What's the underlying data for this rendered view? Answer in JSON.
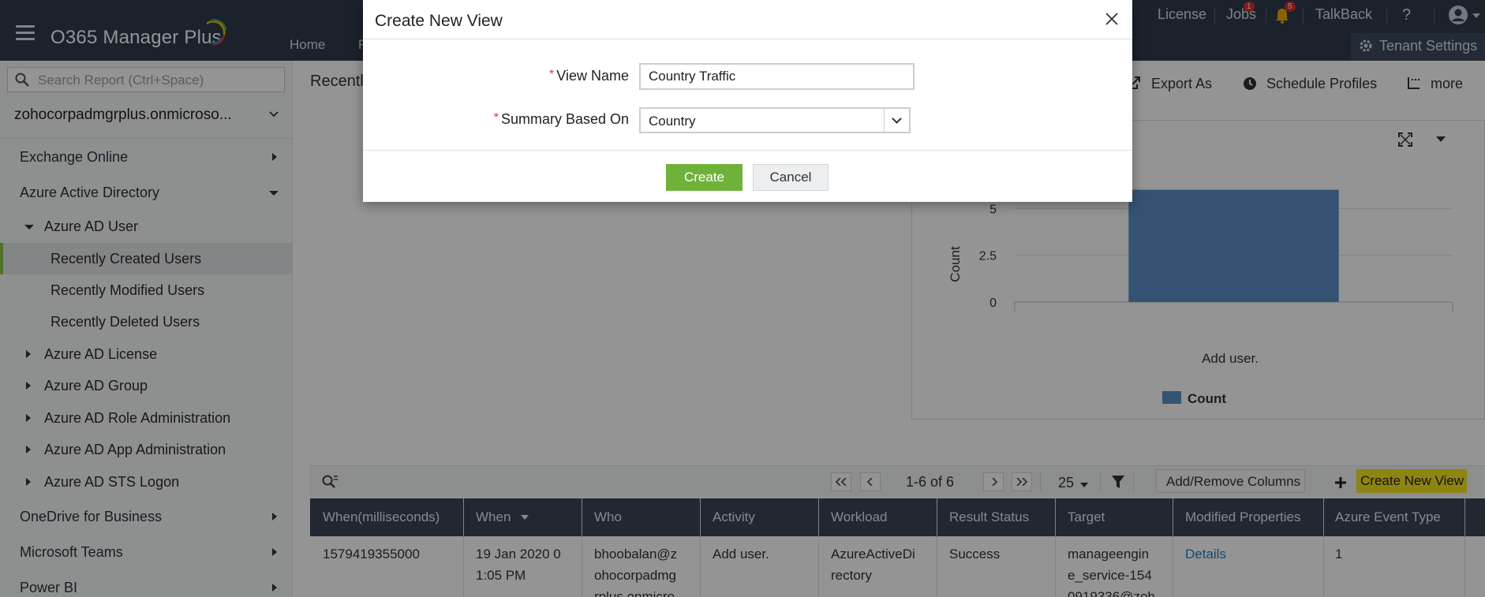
{
  "header": {
    "app_title": "O365 Manager Plus",
    "nav_home": "Home",
    "nav_partial": "F",
    "license": "License",
    "jobs": "Jobs",
    "jobs_badge": "1",
    "alerts_badge": "5",
    "talkback": "TalkBack",
    "help": "?",
    "tenant_settings": "Tenant Settings"
  },
  "sidebar": {
    "search_placeholder": "Search Report (Ctrl+Space)",
    "tenant": "zohocorpadmgrplus.onmicroso...",
    "items": [
      {
        "label": "Exchange Online"
      },
      {
        "label": "Azure Active Directory"
      },
      {
        "label": "Azure AD User"
      },
      {
        "label": "Recently Created Users"
      },
      {
        "label": "Recently Modified Users"
      },
      {
        "label": "Recently Deleted Users"
      },
      {
        "label": "Azure AD License"
      },
      {
        "label": "Azure AD Group"
      },
      {
        "label": "Azure AD Role Administration"
      },
      {
        "label": "Azure AD App Administration"
      },
      {
        "label": "Azure AD STS Logon"
      },
      {
        "label": "OneDrive for Business"
      },
      {
        "label": "Microsoft Teams"
      },
      {
        "label": "Power BI"
      }
    ]
  },
  "main": {
    "title_partial": "Recentl",
    "export_as": "Export As",
    "schedule_profiles": "Schedule Profiles",
    "more": "more"
  },
  "chart_data": {
    "type": "bar",
    "categories": [
      "Add user."
    ],
    "series": [
      {
        "name": "Count",
        "values": [
          6
        ]
      }
    ],
    "ylabel": "Count",
    "yticks": [
      "0",
      "2.5",
      "5"
    ],
    "ylim": [
      0,
      7.5
    ],
    "legend_position": "bottom",
    "bar_color": "#5b8fc7"
  },
  "table": {
    "pager": "1-6 of 6",
    "page_size": "25",
    "add_remove_columns": "Add/Remove Columns",
    "create_new_view": "Create New View",
    "columns": [
      "When(milliseconds)",
      "When",
      "Who",
      "Activity",
      "Workload",
      "Result Status",
      "Target",
      "Modified Properties",
      "Azure Event Type"
    ],
    "row": {
      "when_ms": "1579419355000",
      "when_l1": "19 Jan 2020 0",
      "when_l2": "1:05 PM",
      "who_l1": "bhoobalan@z",
      "who_l2": "ohocorpadmg",
      "who_l3": "rplus.onmicro",
      "activity": "Add user.",
      "workload_l1": "AzureActiveDi",
      "workload_l2": "rectory",
      "result": "Success",
      "target_l1": "manageengin",
      "target_l2": "e_service-154",
      "target_l3": "0919336@zoh",
      "modified": "Details",
      "event_type": "1"
    }
  },
  "modal": {
    "title": "Create New View",
    "view_name_label": "View Name",
    "view_name_value": "Country Traffic",
    "summary_label": "Summary Based On",
    "summary_value": "Country",
    "create": "Create",
    "cancel": "Cancel"
  },
  "colors": {
    "header_bg": "#2f3b4c",
    "create_button": "#6eb23a",
    "highlight": "#f5e61e",
    "required_star": "#e03a3a"
  }
}
